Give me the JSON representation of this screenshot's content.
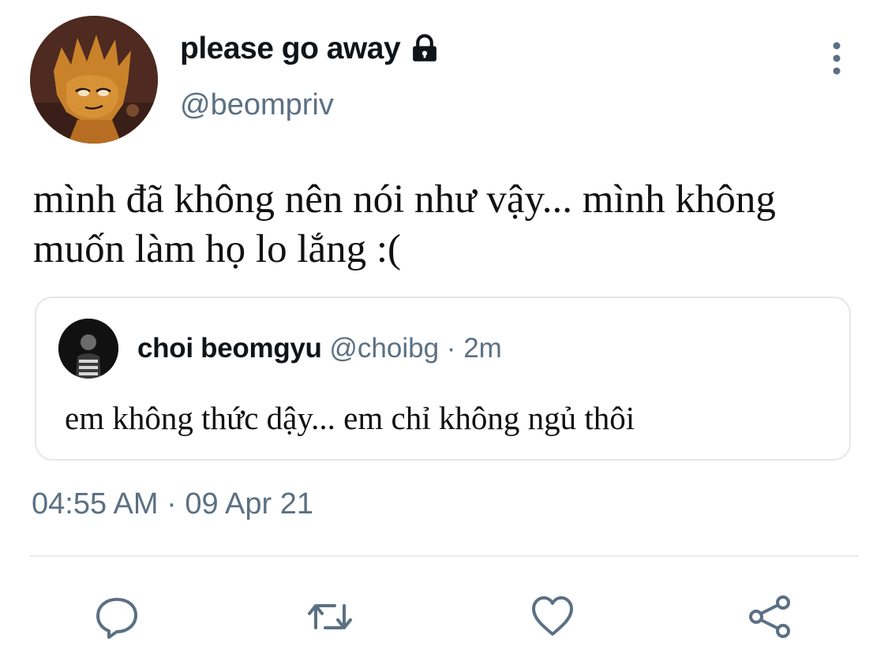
{
  "author": {
    "display_name": "please go away",
    "handle": "@beompriv",
    "avatar_icon": "cartoon-girl-avatar",
    "protected_icon": "lock-icon"
  },
  "tweet": {
    "text": "mình đã không nên nói như vậy... mình không muốn làm họ lo lắng :(",
    "timestamp": "04:55 AM · 09 Apr 21"
  },
  "quoted_tweet": {
    "display_name": "choi beomgyu",
    "handle": "@choibg",
    "separator": "·",
    "time_ago": "2m",
    "text": "em không thức dậy... em chỉ không ngủ thôi",
    "avatar_icon": "person-avatar"
  },
  "actions": {
    "reply_icon": "reply-icon",
    "retweet_icon": "retweet-icon",
    "like_icon": "heart-icon",
    "share_icon": "share-icon"
  },
  "colors": {
    "primary_text": "#0f1419",
    "secondary_text": "#5b7083",
    "border": "#e3e7ea",
    "icon": "#5b7083"
  }
}
